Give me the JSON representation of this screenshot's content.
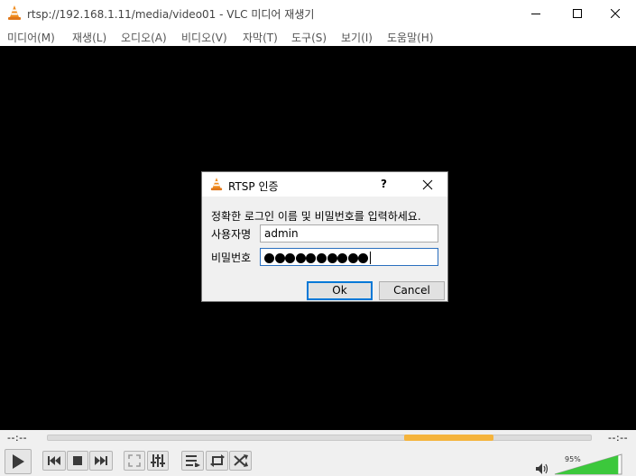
{
  "window": {
    "title": "rtsp://192.168.1.11/media/video01 - VLC 미디어 재생기"
  },
  "menu": {
    "items": [
      "미디어(M)",
      "재생(L)",
      "오디오(A)",
      "비디오(V)",
      "자막(T)",
      "도구(S)",
      "보기(I)",
      "도움말(H)"
    ]
  },
  "dialog": {
    "title": "RTSP 인증",
    "help": "?",
    "message": "정확한 로그인 이름 및 비밀번호를 입력하세요.",
    "username_label": "사용자명",
    "username_value": "admin",
    "password_label": "비밀번호",
    "password_length": 10,
    "ok_label": "Ok",
    "cancel_label": "Cancel"
  },
  "seek": {
    "elapsed": "--:--",
    "remaining": "--:--",
    "buffer_start_fraction": 0.655,
    "buffer_end_fraction": 0.82
  },
  "volume": {
    "level_text": "95%",
    "level": 0.95
  },
  "colors": {
    "accent": "#0078d7",
    "buffer": "#f5b43c",
    "volume": "#3cc83c"
  }
}
